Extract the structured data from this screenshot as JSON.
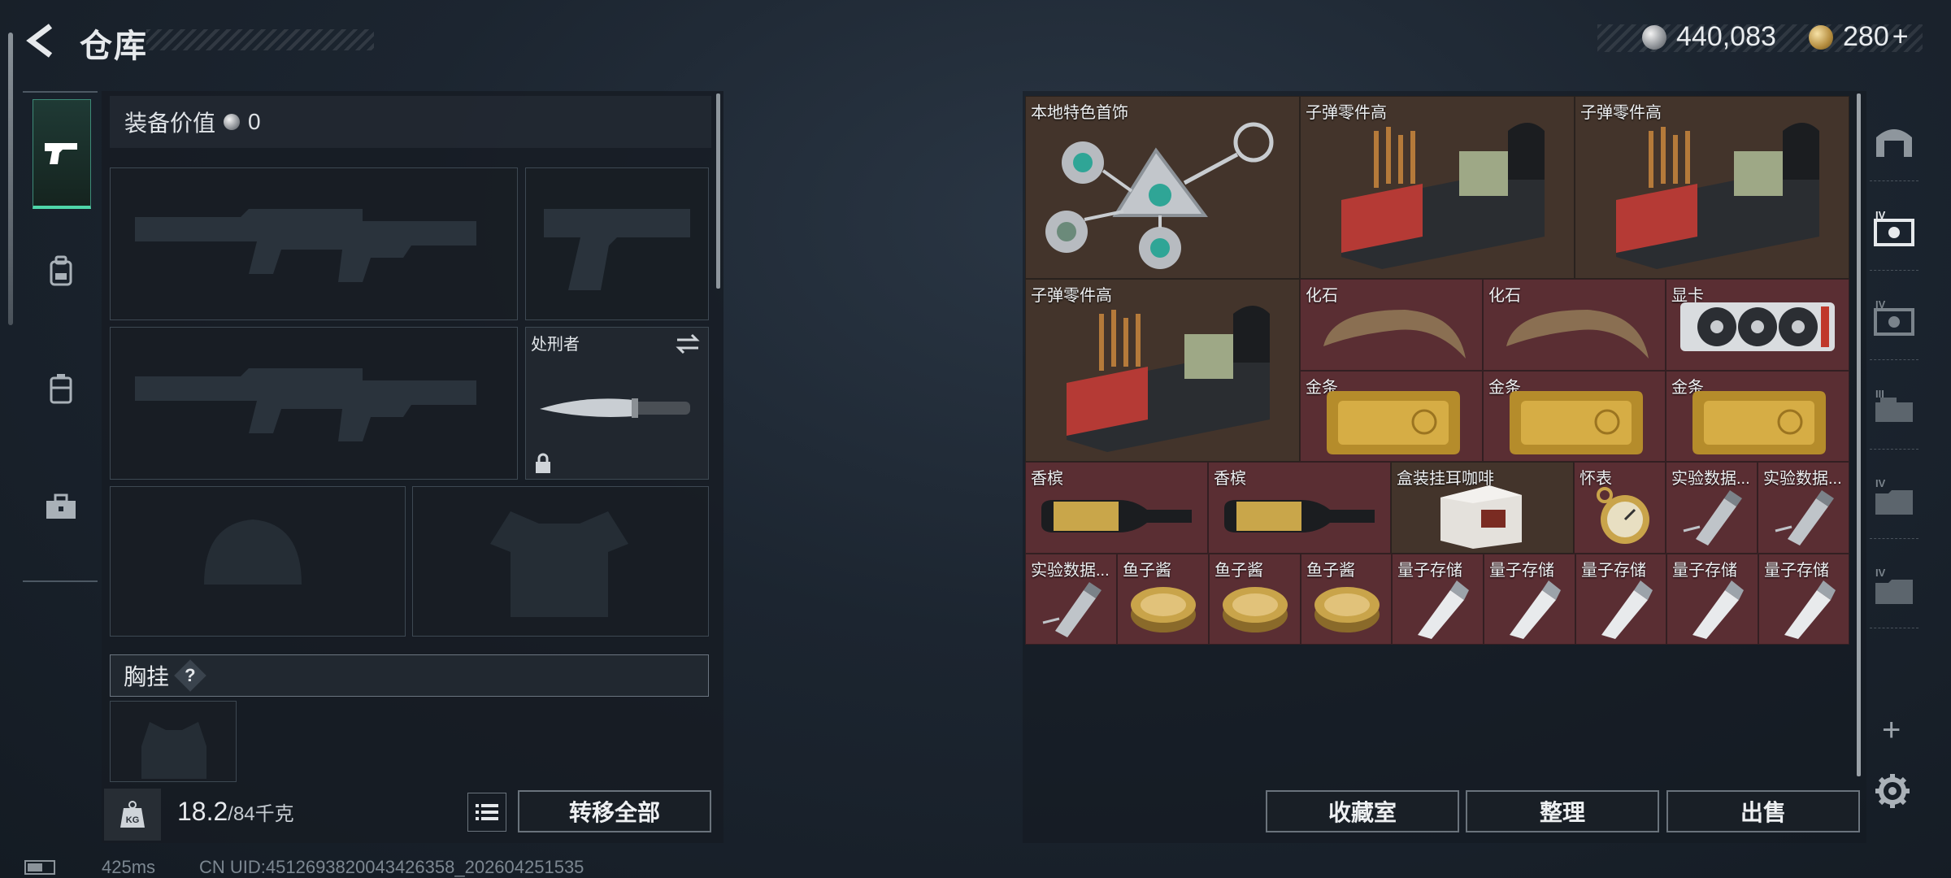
{
  "header": {
    "title": "仓库",
    "silver": "440,083",
    "gold": "280",
    "gold_plus": "+"
  },
  "equipment": {
    "value_label": "装备价值",
    "value": "0",
    "melee_label": "处刑者",
    "chest_rig_label": "胸挂",
    "chest_rig_help": "?",
    "weight_current": "18.2",
    "weight_max": "/84千克",
    "kg_icon_text": "KG",
    "transfer_all": "转移全部"
  },
  "stash": {
    "items": [
      {
        "label": "本地特色首饰"
      },
      {
        "label": "子弹零件高"
      },
      {
        "label": "子弹零件高"
      },
      {
        "label": "子弹零件高"
      },
      {
        "label": "化石"
      },
      {
        "label": "化石"
      },
      {
        "label": "显卡"
      },
      {
        "label": "金条"
      },
      {
        "label": "金条"
      },
      {
        "label": "金条"
      },
      {
        "label": "香槟"
      },
      {
        "label": "香槟"
      },
      {
        "label": "盒装挂耳咖啡"
      },
      {
        "label": "怀表"
      },
      {
        "label": "实验数据..."
      },
      {
        "label": "实验数据..."
      },
      {
        "label": "实验数据..."
      },
      {
        "label": "鱼子酱"
      },
      {
        "label": "鱼子酱"
      },
      {
        "label": "鱼子酱"
      },
      {
        "label": "量子存储"
      },
      {
        "label": "量子存储"
      },
      {
        "label": "量子存储"
      },
      {
        "label": "量子存储"
      },
      {
        "label": "量子存储"
      }
    ],
    "collection_button": "收藏室",
    "sort_button": "整理",
    "sell_button": "出售"
  },
  "right_tabs": [
    "IV",
    "IV",
    "III",
    "IV",
    "IV"
  ],
  "footer": {
    "ping": "425ms",
    "uid": "CN UID:4512693820043426358_202604251535"
  }
}
